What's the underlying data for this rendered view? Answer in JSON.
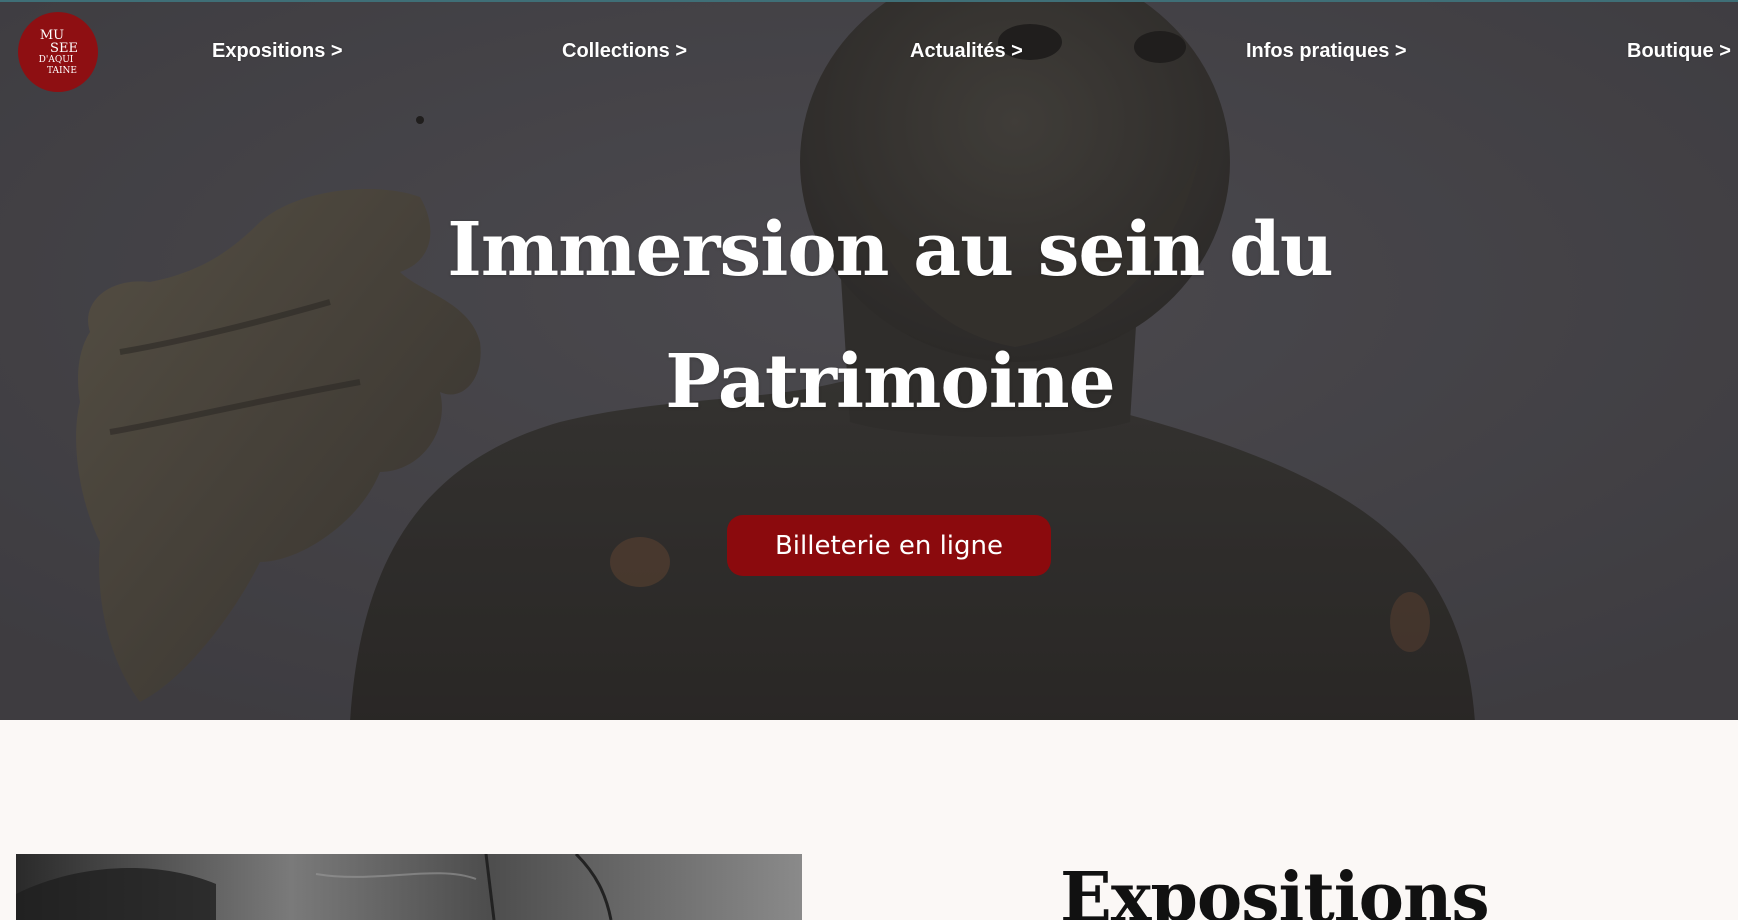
{
  "logo": {
    "lines": [
      "MU",
      "SEE",
      "D'AQUI",
      "TAINE"
    ],
    "color": "#8e0f12"
  },
  "nav": {
    "items": [
      {
        "label": "Expositions >"
      },
      {
        "label": "Collections >"
      },
      {
        "label": "Actualités >"
      },
      {
        "label": "Infos pratiques >"
      },
      {
        "label": "Boutique >"
      }
    ]
  },
  "hero": {
    "title_line1": "Immersion au sein du",
    "title_line2": "Patrimoine",
    "button_label": "Billeterie en ligne",
    "button_color": "#8b0a0d"
  },
  "expositions": {
    "title": "Expositions"
  }
}
